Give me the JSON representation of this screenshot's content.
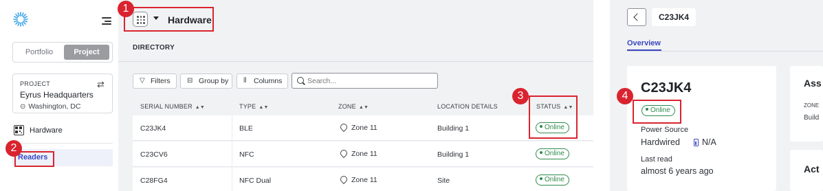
{
  "sidebar": {
    "segment": {
      "portfolio": "Portfolio",
      "project": "Project"
    },
    "project_card": {
      "label": "PROJECT",
      "name": "Eyrus Headquarters",
      "location": "Washington, DC"
    },
    "nav": {
      "hardware": "Hardware",
      "readers": "Readers"
    }
  },
  "main": {
    "title": "Hardware",
    "directory_label": "DIRECTORY",
    "toolbar": {
      "filters": "Filters",
      "group_by": "Group by",
      "columns": "Columns",
      "search_placeholder": "Search..."
    },
    "table": {
      "headers": [
        "SERIAL NUMBER",
        "TYPE",
        "ZONE",
        "LOCATION DETAILS",
        "STATUS"
      ],
      "rows": [
        {
          "serial": "C23JK4",
          "type": "BLE",
          "zone": "Zone 11",
          "location": "Building 1",
          "status": "Online"
        },
        {
          "serial": "C23CV6",
          "type": "NFC",
          "zone": "Zone 11",
          "location": "Building 1",
          "status": "Online"
        },
        {
          "serial": "C28FG4",
          "type": "NFC Dual",
          "zone": "Zone 11",
          "location": "Site",
          "status": "Online"
        }
      ]
    }
  },
  "detail": {
    "header_title": "C23JK4",
    "tab_overview": "Overview",
    "card": {
      "title": "C23JK4",
      "status": "Online",
      "power_source_label": "Power Source",
      "power_source_value": "Hardwired",
      "battery_value": "N/A",
      "last_read_label": "Last read",
      "last_read_value": "almost 6 years ago"
    },
    "card2": {
      "title": "Ass",
      "zone_label": "ZONE",
      "zone_value": "Build"
    },
    "card3": {
      "title": "Act"
    }
  },
  "annotations": [
    "1",
    "2",
    "3",
    "4"
  ],
  "colors": {
    "accent": "#3a47c0",
    "online": "#2e8a4a",
    "annotation": "#d9232e",
    "panel_bg": "#f1f2f4"
  }
}
